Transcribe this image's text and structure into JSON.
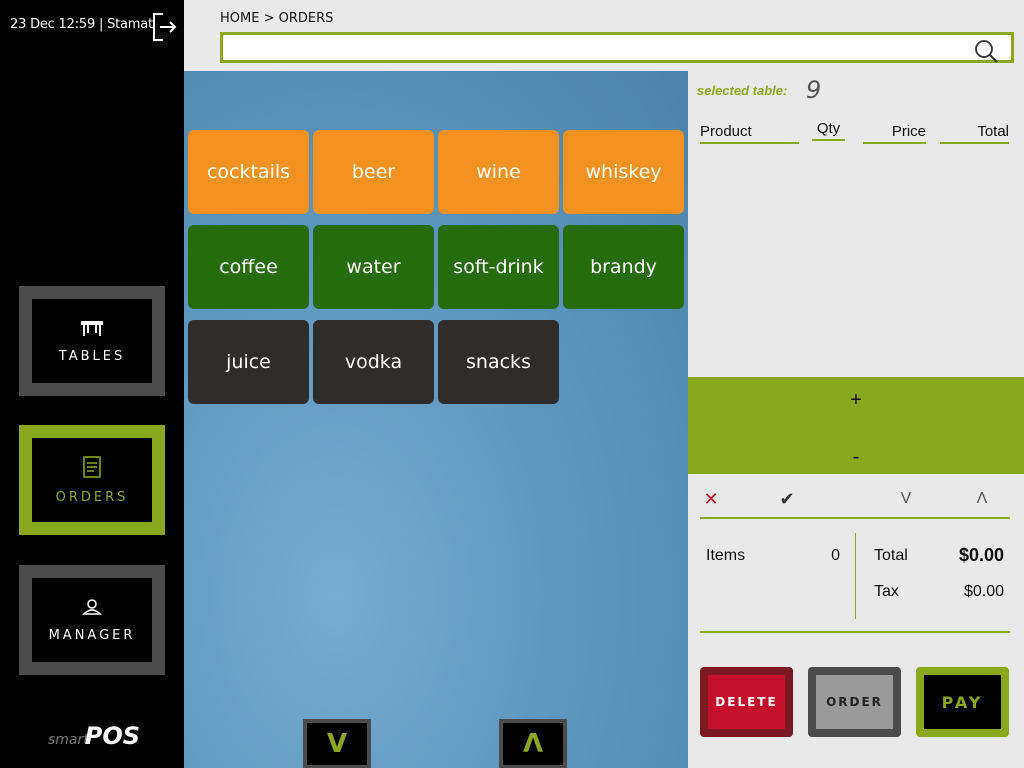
{
  "sidebar": {
    "user_line": "23 Dec 12:59 | Stamat",
    "nav": [
      {
        "label": "TABLES",
        "icon": "table-icon",
        "active": false
      },
      {
        "label": "ORDERS",
        "icon": "receipt-icon",
        "active": true
      },
      {
        "label": "MANAGER",
        "icon": "person-icon",
        "active": false
      }
    ],
    "logo": {
      "smart": "smart",
      "pos": "POS"
    }
  },
  "header": {
    "breadcrumb": "HOME > ORDERS",
    "search_value": "",
    "search_placeholder": ""
  },
  "categories": [
    {
      "label": "cocktails",
      "color": "orange"
    },
    {
      "label": "beer",
      "color": "orange"
    },
    {
      "label": "wine",
      "color": "orange"
    },
    {
      "label": "whiskey",
      "color": "orange"
    },
    {
      "label": "coffee",
      "color": "green"
    },
    {
      "label": "water",
      "color": "green"
    },
    {
      "label": "soft-drink",
      "color": "green"
    },
    {
      "label": "brandy",
      "color": "green"
    },
    {
      "label": "juice",
      "color": "dark"
    },
    {
      "label": "vodka",
      "color": "dark"
    },
    {
      "label": "snacks",
      "color": "dark"
    }
  ],
  "paging": {
    "down": "V",
    "up": "Λ"
  },
  "order_panel": {
    "selected_table_label": "selected table:",
    "selected_table": "9",
    "columns": {
      "product": "Product",
      "qty": "Qty",
      "price": "Price",
      "total": "Total"
    },
    "qty_plus": "+",
    "qty_minus": "-",
    "actions": {
      "cancel": "✕",
      "confirm": "✔",
      "down": "V",
      "up": "Λ"
    },
    "summary": {
      "items_label": "Items",
      "items_value": "0",
      "total_label": "Total",
      "total_value": "$0.00",
      "tax_label": "Tax",
      "tax_value": "$0.00"
    },
    "buttons": {
      "delete": "DELETE",
      "order": "ORDER",
      "pay": "PAY"
    }
  },
  "colors": {
    "accent": "#8aa81e",
    "orange": "#f39221",
    "green": "#266b0c",
    "dark": "#2f2d2b",
    "delete": "#c4102a"
  }
}
